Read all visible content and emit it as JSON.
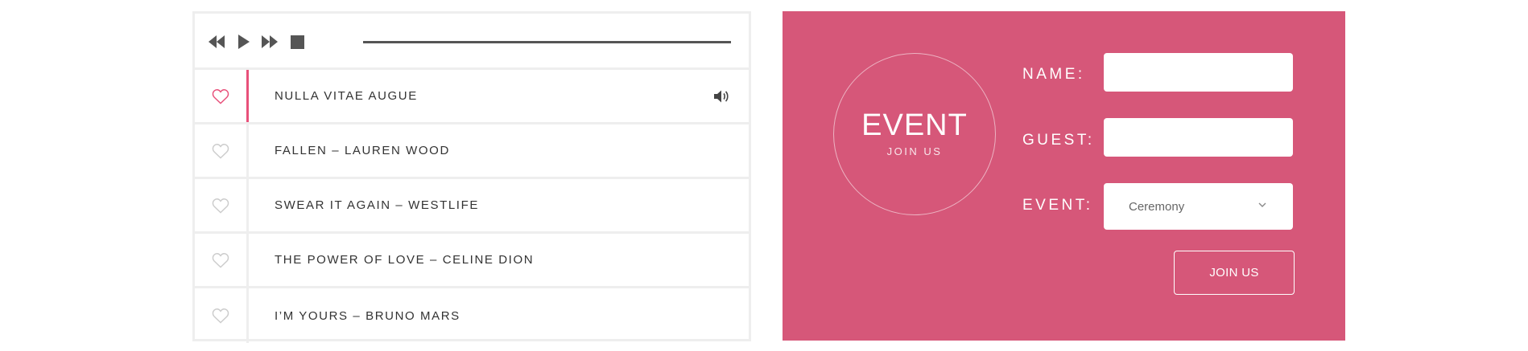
{
  "player": {
    "controls": [
      {
        "name": "rewind-icon"
      },
      {
        "name": "play-icon"
      },
      {
        "name": "fast-forward-icon"
      },
      {
        "name": "stop-icon"
      }
    ],
    "tracks": [
      {
        "title": "NULLA VITAE AUGUE",
        "active": true
      },
      {
        "title": "FALLEN – LAUREN WOOD",
        "active": false
      },
      {
        "title": "SWEAR IT AGAIN – WESTLIFE",
        "active": false
      },
      {
        "title": "THE POWER OF LOVE – CELINE DION",
        "active": false
      },
      {
        "title": "I’M YOURS – BRUNO MARS",
        "active": false
      }
    ],
    "colors": {
      "accent": "#e8507a",
      "heart_inactive": "#cccccc",
      "icon": "#555555"
    }
  },
  "event": {
    "badge_title": "EVENT",
    "badge_subtitle": "JOIN US",
    "name_label": "NAME:",
    "name_value": "",
    "guest_label": "GUEST:",
    "guest_value": "",
    "event_label": "EVENT:",
    "event_selected": "Ceremony",
    "join_label": "JOIN US",
    "colors": {
      "background": "#d65779"
    }
  }
}
